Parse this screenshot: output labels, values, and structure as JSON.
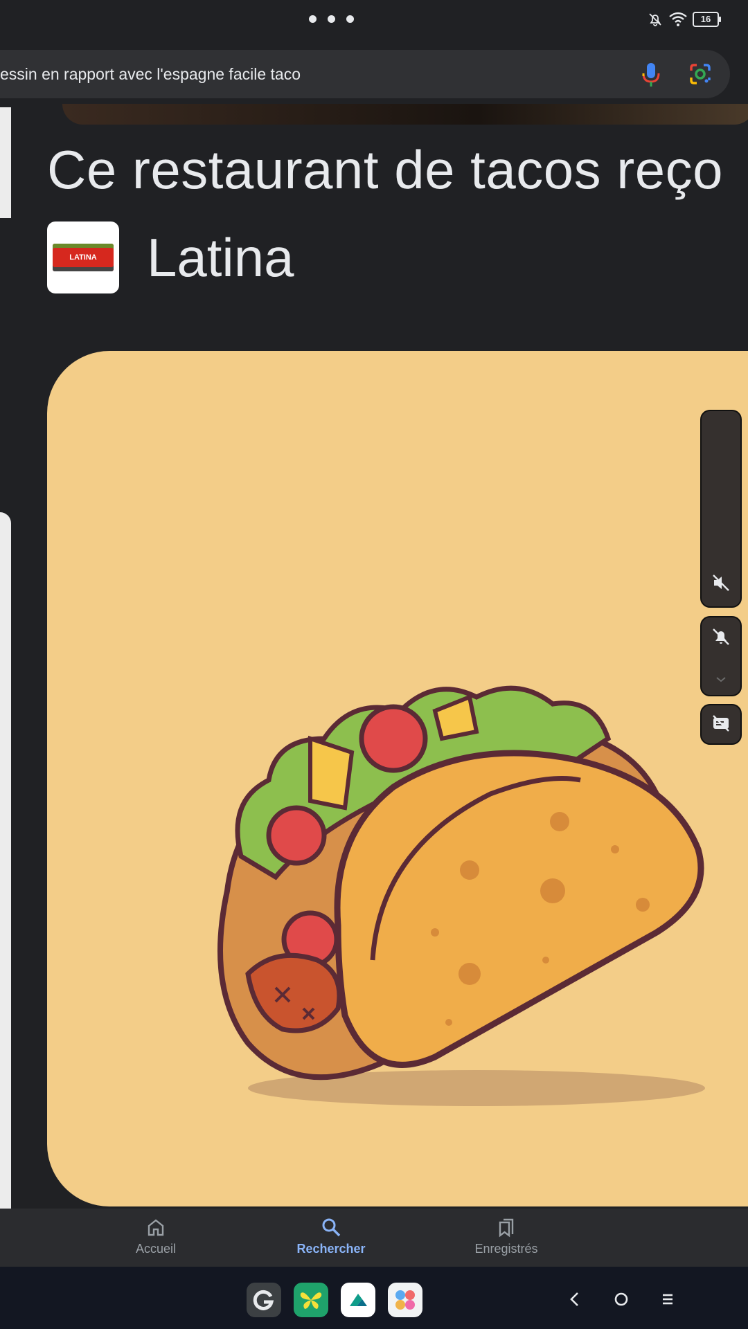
{
  "status_bar": {
    "battery_level": "16"
  },
  "search": {
    "query": "essin en rapport avec l'espagne facile taco"
  },
  "article": {
    "headline": "Ce restaurant de tacos reço",
    "source_name": "Latina",
    "source_logo_text": "LATINA"
  },
  "bottom_nav": {
    "items": [
      {
        "label": "Accueil",
        "icon": "home-icon",
        "active": false
      },
      {
        "label": "Rechercher",
        "icon": "search-icon",
        "active": true
      },
      {
        "label": "Enregistrés",
        "icon": "bookmarks-icon",
        "active": false
      }
    ]
  },
  "colors": {
    "accent": "#8ab4f8",
    "background": "#202124",
    "hero_bg": "#f3cd88"
  }
}
